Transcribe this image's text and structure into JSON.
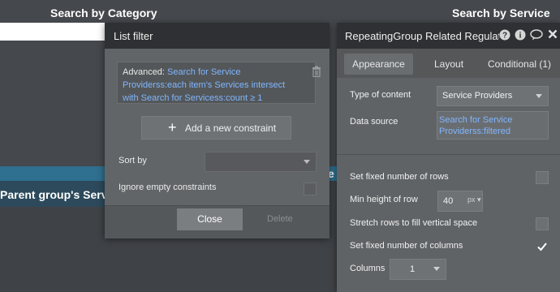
{
  "canvas": {
    "left_heading": "Search by Category",
    "right_heading": "Search by Service",
    "band_text": "Parent group's Servic",
    "edge_char": "e"
  },
  "list_filter": {
    "title": "List filter",
    "constraint_prefix": "Advanced:",
    "constraint_expression": "Search for Service Providerss:each item's Services intersect with Search for Servicess:count ≥ 1",
    "add_constraint_label": "Add a new constraint",
    "sort_by_label": "Sort by",
    "sort_by_value": "",
    "ignore_empty_label": "Ignore empty constraints",
    "ignore_empty_checked": false,
    "close_label": "Close",
    "delete_label": "Delete"
  },
  "property_editor": {
    "title": "RepeatingGroup Related Regulatio",
    "header_icons": [
      "help-icon",
      "info-icon",
      "comment-icon",
      "close-icon"
    ],
    "tabs": [
      {
        "label": "Appearance",
        "active": true
      },
      {
        "label": "Layout",
        "active": false
      },
      {
        "label": "Conditional (1)",
        "active": false
      }
    ],
    "type_of_content_label": "Type of content",
    "type_of_content_value": "Service Providers",
    "data_source_label": "Data source",
    "data_source_value": "Search for Service Providerss:filtered",
    "fixed_rows_label": "Set fixed number of rows",
    "fixed_rows_checked": false,
    "min_height_label": "Min height of row",
    "min_height_value": "40",
    "min_height_unit": "px",
    "stretch_rows_label": "Stretch rows to fill vertical space",
    "stretch_rows_checked": false,
    "fixed_columns_label": "Set fixed number of columns",
    "fixed_columns_checked": true,
    "columns_label": "Columns",
    "columns_value": "1"
  },
  "colors": {
    "link_blue": "#7fb6ff",
    "header_dark": "#2e3033",
    "band_blue": "#2f6f8f"
  }
}
